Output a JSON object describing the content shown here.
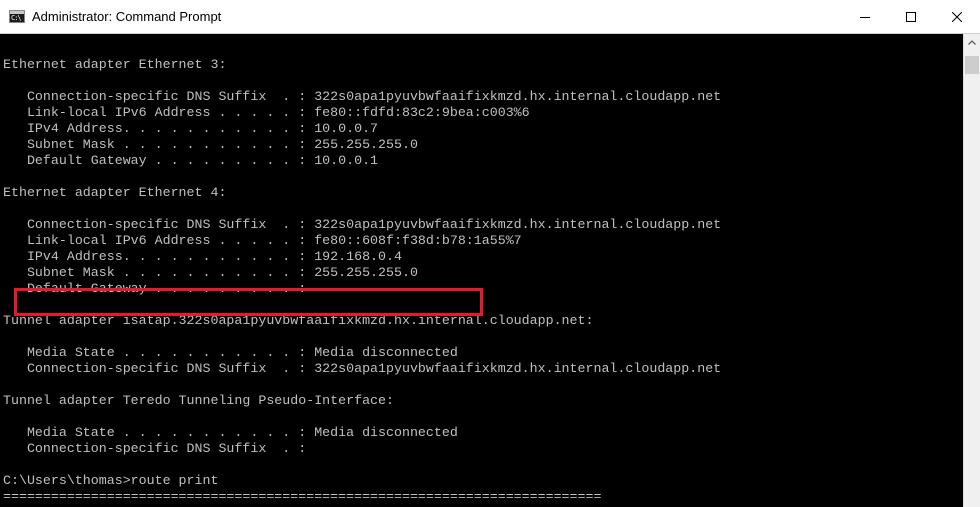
{
  "window": {
    "title": "Administrator: Command Prompt",
    "icon": "cmd-icon",
    "icon_glyph": "C:\\",
    "controls": [
      "minimize-icon",
      "maximize-icon",
      "close-icon"
    ]
  },
  "console": {
    "lines": [
      "",
      "Ethernet adapter Ethernet 3:",
      "",
      "   Connection-specific DNS Suffix  . : 322s0apa1pyuvbwfaaifixkmzd.hx.internal.cloudapp.net",
      "   Link-local IPv6 Address . . . . . : fe80::fdfd:83c2:9bea:c003%6",
      "   IPv4 Address. . . . . . . . . . . : 10.0.0.7",
      "   Subnet Mask . . . . . . . . . . . : 255.255.255.0",
      "   Default Gateway . . . . . . . . . : 10.0.0.1",
      "",
      "Ethernet adapter Ethernet 4:",
      "",
      "   Connection-specific DNS Suffix  . : 322s0apa1pyuvbwfaaifixkmzd.hx.internal.cloudapp.net",
      "   Link-local IPv6 Address . . . . . : fe80::608f:f38d:b78:1a55%7",
      "   IPv4 Address. . . . . . . . . . . : 192.168.0.4",
      "   Subnet Mask . . . . . . . . . . . : 255.255.255.0",
      "   Default Gateway . . . . . . . . . :",
      "",
      "Tunnel adapter isatap.322s0apa1pyuvbwfaaifixkmzd.hx.internal.cloudapp.net:",
      "",
      "   Media State . . . . . . . . . . . : Media disconnected",
      "   Connection-specific DNS Suffix  . : 322s0apa1pyuvbwfaaifixkmzd.hx.internal.cloudapp.net",
      "",
      "Tunnel adapter Teredo Tunneling Pseudo-Interface:",
      "",
      "   Media State . . . . . . . . . . . : Media disconnected",
      "   Connection-specific DNS Suffix  . :",
      "",
      "C:\\Users\\thomas>route print",
      "==========================================================================="
    ]
  },
  "annotation": {
    "color": "#e8192c"
  }
}
